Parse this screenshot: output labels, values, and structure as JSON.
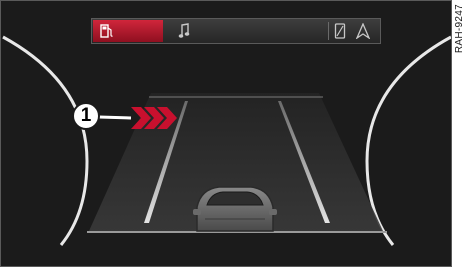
{
  "reference_code": "RAH-9247",
  "callout": {
    "number": "1"
  },
  "top_bar": {
    "tabs": [
      {
        "icon": "fuel-pump-icon",
        "active": true
      },
      {
        "icon": "music-note-icon",
        "active": false
      }
    ],
    "right_icons": [
      "phone-icon",
      "navigation-arrow-icon"
    ]
  },
  "colors": {
    "accent": "#c8102e",
    "panel_background": "#1b1b1b",
    "line": "#d8d8d8"
  }
}
